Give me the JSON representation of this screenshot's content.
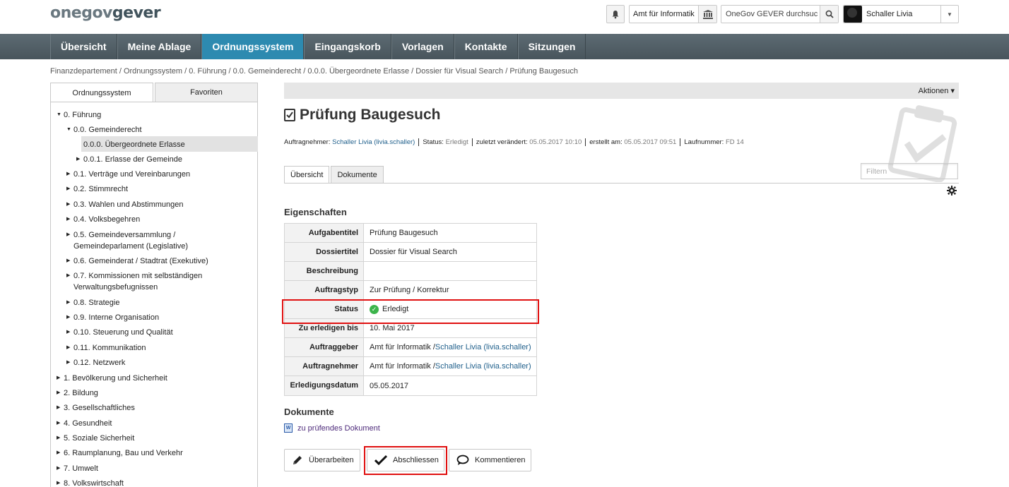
{
  "header": {
    "logo_one": "onegov",
    "logo_two": "gever",
    "org_label": "Amt für Informatik",
    "search_value": "OneGov GEVER durchsuc",
    "user_name": "Schaller Livia"
  },
  "nav": {
    "items": [
      "Übersicht",
      "Meine Ablage",
      "Ordnungssystem",
      "Eingangskorb",
      "Vorlagen",
      "Kontakte",
      "Sitzungen"
    ],
    "active": "Ordnungssystem"
  },
  "breadcrumb": "Finanzdepartement / Ordnungssystem / 0. Führung / 0.0. Gemeinderecht / 0.0.0. Übergeordnete Erlasse / Dossier für Visual Search / Prüfung Baugesuch",
  "sidebar": {
    "tab_tree": "Ordnungssystem",
    "tab_favorites": "Favoriten",
    "tree": [
      {
        "label": "0. Führung",
        "expanded": true
      },
      {
        "label": "0.0. Gemeinderecht",
        "expanded": true
      },
      {
        "label": "0.0.0. Übergeordnete Erlasse",
        "selected": true
      },
      {
        "label": "0.0.1. Erlasse der Gemeinde"
      },
      {
        "label": "0.1. Verträge und Vereinbarungen"
      },
      {
        "label": "0.2. Stimmrecht"
      },
      {
        "label": "0.3. Wahlen und Abstimmungen"
      },
      {
        "label": "0.4. Volksbegehren"
      },
      {
        "label": "0.5. Gemeindeversammlung /",
        "label2": "Gemeindeparlament (Legislative)"
      },
      {
        "label": "0.6. Gemeinderat / Stadtrat (Exekutive)"
      },
      {
        "label": "0.7. Kommissionen mit selbständigen",
        "label2": "Verwaltungsbefugnissen"
      },
      {
        "label": "0.8. Strategie"
      },
      {
        "label": "0.9. Interne Organisation"
      },
      {
        "label": "0.10. Steuerung und Qualität"
      },
      {
        "label": "0.11. Kommunikation"
      },
      {
        "label": "0.12. Netzwerk"
      },
      {
        "label": "1. Bevölkerung und Sicherheit"
      },
      {
        "label": "2. Bildung"
      },
      {
        "label": "3. Gesellschaftliches"
      },
      {
        "label": "4. Gesundheit"
      },
      {
        "label": "5. Soziale Sicherheit"
      },
      {
        "label": "6. Raumplanung, Bau und Verkehr"
      },
      {
        "label": "7. Umwelt"
      },
      {
        "label": "8. Volkswirtschaft"
      }
    ]
  },
  "main": {
    "actions_label": "Aktionen ▾",
    "title": "Prüfung Baugesuch",
    "meta": {
      "assignee_label": "Auftragnehmer:",
      "assignee_value": "Schaller Livia (livia.schaller)",
      "status_label": "Status:",
      "status_value": "Erledigt",
      "modified_label": "zuletzt verändert:",
      "modified_value": "05.05.2017 10:10",
      "created_label": "erstellt am:",
      "created_value": "05.05.2017 09:51",
      "seq_label": "Laufnummer:",
      "seq_value": "FD 14"
    },
    "tabs": [
      "Übersicht",
      "Dokumente"
    ],
    "filter_placeholder": "Filtern",
    "properties_heading": "Eigenschaften",
    "properties": [
      {
        "key": "Aufgabentitel",
        "value": "Prüfung Baugesuch"
      },
      {
        "key": "Dossiertitel",
        "value": "Dossier für Visual Search"
      },
      {
        "key": "Beschreibung",
        "value": ""
      },
      {
        "key": "Auftragstyp",
        "value": "Zur Prüfung / Korrektur"
      },
      {
        "key": "Status",
        "value": "Erledigt"
      },
      {
        "key": "Zu erledigen bis",
        "value": "10. Mai 2017"
      },
      {
        "key": "Auftraggeber",
        "value_prefix": "Amt für Informatik / ",
        "value_link": "Schaller Livia (livia.schaller)"
      },
      {
        "key": "Auftragnehmer",
        "value_prefix": "Amt für Informatik / ",
        "value_link": "Schaller Livia (livia.schaller)"
      },
      {
        "key": "Erledigungsdatum",
        "value": "05.05.2017"
      }
    ],
    "documents_heading": "Dokumente",
    "document_link": "zu prüfendes Dokument",
    "buttons": {
      "edit": "Überarbeiten",
      "close": "Abschliessen",
      "comment": "Kommentieren"
    }
  },
  "colors": {
    "nav_active": "#2d8ab0",
    "highlight": "#e01010",
    "status_ok": "#3cb44b"
  }
}
